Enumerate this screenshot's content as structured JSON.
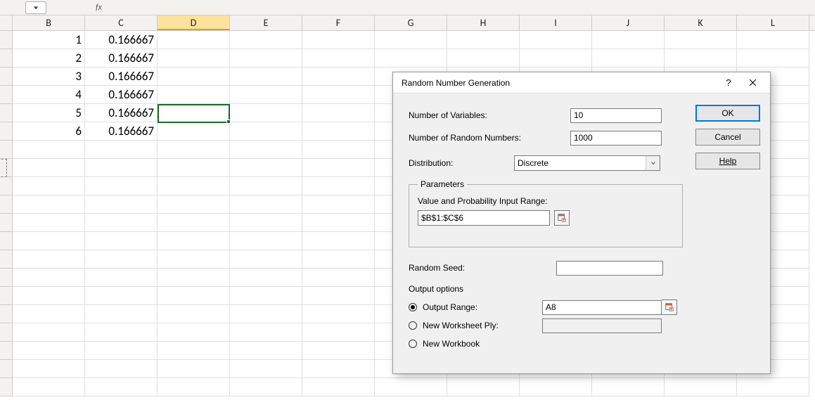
{
  "formula_bar": {
    "fx": "fx"
  },
  "columns": [
    "B",
    "C",
    "D",
    "E",
    "F",
    "G",
    "H",
    "I",
    "J",
    "K",
    "L"
  ],
  "selected_column": "D",
  "cells": {
    "B1": "1",
    "C1": "0.166667",
    "B2": "2",
    "C2": "0.166667",
    "B3": "3",
    "C3": "0.166667",
    "B4": "4",
    "C4": "0.166667",
    "B5": "5",
    "C5": "0.166667",
    "B6": "6",
    "C6": "0.166667"
  },
  "dialog": {
    "title": "Random Number Generation",
    "labels": {
      "num_vars": "Number of Variables:",
      "num_rand": "Number of Random Numbers:",
      "distribution": "Distribution:",
      "parameters_legend": "Parameters",
      "value_prob_range": "Value and Probability Input Range:",
      "random_seed": "Random Seed:",
      "output_options": "Output options",
      "output_range": "Output Range:",
      "new_ws_ply": "New Worksheet Ply:",
      "new_workbook": "New Workbook"
    },
    "values": {
      "num_vars": "10",
      "num_rand": "1000",
      "distribution": "Discrete",
      "value_prob_range": "$B$1:$C$6",
      "random_seed": "",
      "output_range": "A8",
      "new_ws_ply": ""
    },
    "buttons": {
      "ok": "OK",
      "cancel": "Cancel",
      "help": "Help"
    },
    "help_mark": "?"
  }
}
